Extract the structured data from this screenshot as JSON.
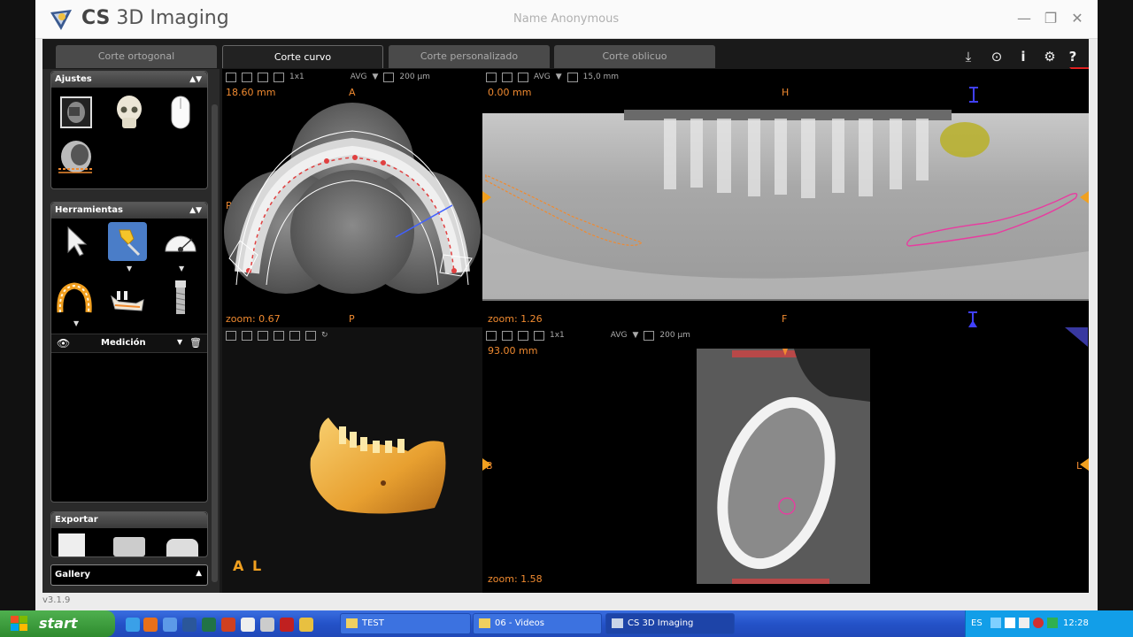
{
  "window": {
    "title_bold": "CS",
    "title_rest": " 3D Imaging",
    "patient_name": "Name Anonymous",
    "version": "v3.1.9"
  },
  "tabs": [
    {
      "label": "Corte ortogonal",
      "active": false
    },
    {
      "label": "Corte curvo",
      "active": true
    },
    {
      "label": "Corte personalizado",
      "active": false
    },
    {
      "label": "Corte oblicuo",
      "active": false
    }
  ],
  "top_icons": [
    "download-icon",
    "target-icon",
    "info-icon",
    "gear-icon",
    "help-icon"
  ],
  "left_panel": {
    "ajustes_title": "Ajustes",
    "herramientas_title": "Herramientas",
    "medicion_label": "Medición",
    "exportar_title": "Exportar",
    "gallery_label": "Gallery"
  },
  "viewports": {
    "axial": {
      "zoom_mode": "1x1",
      "avg": "AVG",
      "thickness": "200 µm",
      "distance": "18.60 mm",
      "zoom": "zoom: 0.67",
      "top": "A",
      "bottom": "P",
      "left": "R",
      "right": "L"
    },
    "panoramic": {
      "avg": "AVG",
      "thickness": "15,0 mm",
      "distance": "0.00 mm",
      "zoom": "zoom: 1.26",
      "top": "H",
      "bottom": "F"
    },
    "volume": {
      "orient_a": "A",
      "orient_l": "L"
    },
    "cross": {
      "zoom_mode": "1x1",
      "avg": "AVG",
      "thickness": "200 µm",
      "distance": "93.00 mm",
      "zoom": "zoom: 1.58",
      "left": "B",
      "right": "L"
    }
  },
  "taskbar": {
    "start": "start",
    "items": [
      {
        "label": "TEST",
        "active": false
      },
      {
        "label": "06 - Videos",
        "active": false
      },
      {
        "label": "CS 3D Imaging",
        "active": true
      }
    ],
    "lang": "ES",
    "clock": "12:28"
  }
}
